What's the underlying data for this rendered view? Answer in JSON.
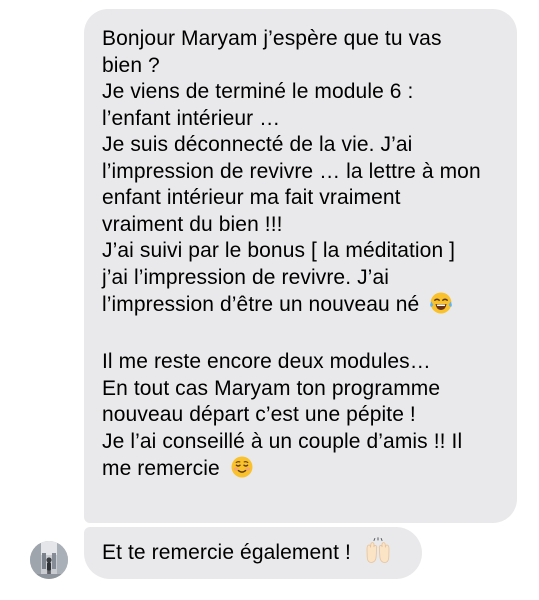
{
  "conversation": {
    "message_1": {
      "lines": [
        "Bonjour Maryam j’espère que tu vas",
        "bien ?",
        "Je viens de terminé le module 6 :",
        "l’enfant intérieur …",
        "Je suis déconnecté de la vie. J’ai",
        "l’impression de revivre … la lettre à mon",
        "enfant intérieur ma fait vraiment",
        "vraiment du bien !!!",
        "J’ai suivi par le bonus [ la méditation ]",
        "j’ai l’impression de revivre. J’ai",
        "l’impression d’être un nouveau né",
        "",
        "Il me reste encore deux modules…",
        "En tout cas Maryam ton programme",
        "nouveau départ c’est une pépite !",
        "Je l’ai conseillé à un couple d’amis !! Il",
        "me remercie"
      ],
      "emoji_after_line_11": "tears-of-joy-emoji",
      "emoji_after_line_17": "smiling-face-emoji"
    },
    "message_2": {
      "text": "Et te remercie également !",
      "emoji": "raising-hands-emoji"
    },
    "colors": {
      "bubble": "#e9e9eb",
      "text": "#000000",
      "background": "#ffffff"
    }
  }
}
